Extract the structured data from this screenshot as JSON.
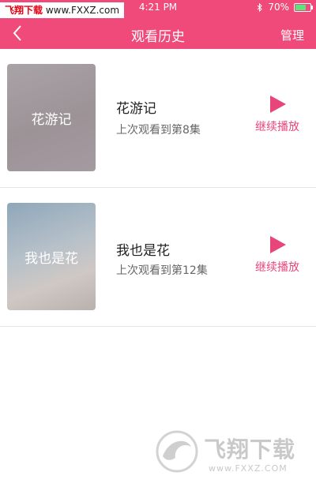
{
  "status_bar": {
    "watermark_red": "飞翔下载",
    "watermark_url": "www.FXXZ.com",
    "time": "4:21 PM",
    "battery": "70%",
    "battery_level": 0.7
  },
  "header": {
    "title": "观看历史",
    "manage_label": "管理"
  },
  "history": [
    {
      "cover_text": "花游记",
      "title": "花游记",
      "progress": "上次观看到第8集",
      "action": "继续播放"
    },
    {
      "cover_text": "我也是花",
      "title": "我也是花",
      "progress": "上次观看到第12集",
      "action": "继续播放"
    }
  ],
  "watermark": {
    "brand": "飞翔下载",
    "url": "www.FXXZ.COM"
  },
  "colors": {
    "accent": "#ef4a79",
    "play": "#e8457a"
  }
}
